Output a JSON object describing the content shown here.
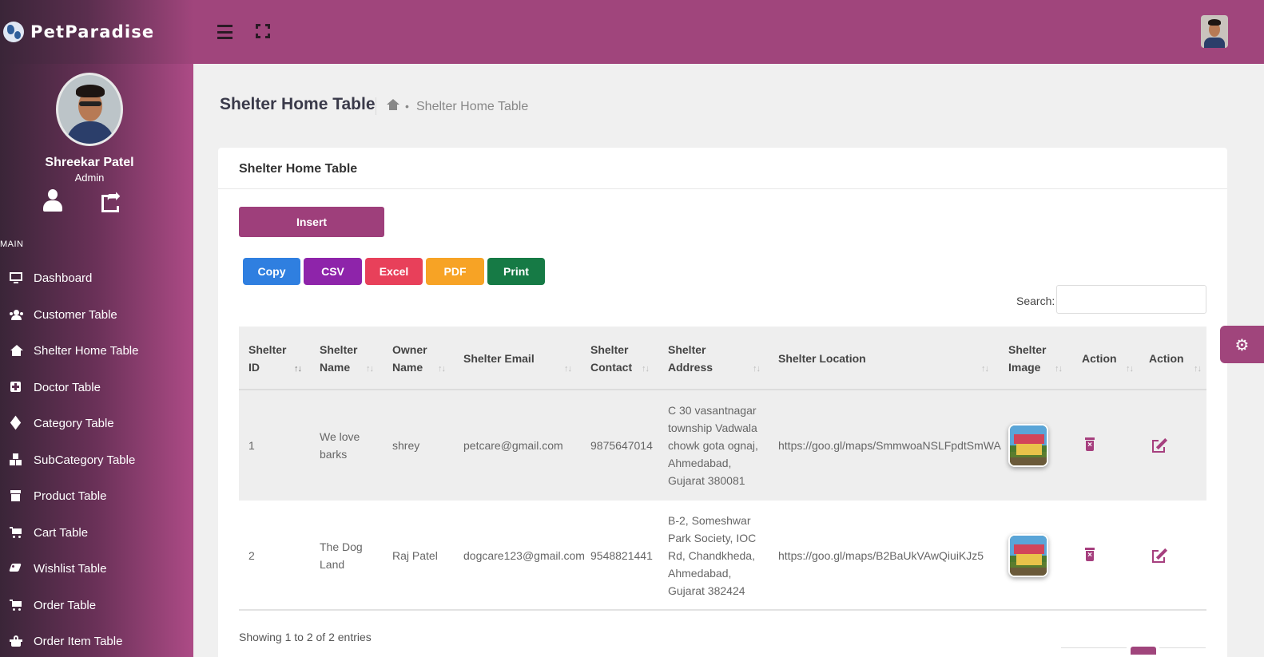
{
  "app": {
    "brand": "PetParadise"
  },
  "user": {
    "name": "Shreekar Patel",
    "role": "Admin"
  },
  "sidebar": {
    "section": "MAIN",
    "items": [
      {
        "label": "Dashboard",
        "icon": "monitor-icon"
      },
      {
        "label": "Customer Table",
        "icon": "users-icon"
      },
      {
        "label": "Shelter Home Table",
        "icon": "home-icon"
      },
      {
        "label": "Doctor Table",
        "icon": "medical-plus-icon"
      },
      {
        "label": "Category Table",
        "icon": "cube-icon"
      },
      {
        "label": "SubCategory Table",
        "icon": "cubes-icon"
      },
      {
        "label": "Product Table",
        "icon": "archive-icon"
      },
      {
        "label": "Cart Table",
        "icon": "cart-icon"
      },
      {
        "label": "Wishlist Table",
        "icon": "tags-icon"
      },
      {
        "label": "Order Table",
        "icon": "cart-icon"
      },
      {
        "label": "Order Item Table",
        "icon": "basket-icon"
      }
    ]
  },
  "page": {
    "title": "Shelter Home Table",
    "breadcrumb_current": "Shelter Home Table"
  },
  "card": {
    "title": "Shelter Home Table",
    "insert_label": "Insert",
    "export_buttons": [
      {
        "label": "Copy",
        "color": "#2f7fe0"
      },
      {
        "label": "CSV",
        "color": "#8e24aa"
      },
      {
        "label": "Excel",
        "color": "#e8405a"
      },
      {
        "label": "PDF",
        "color": "#f7a325"
      },
      {
        "label": "Print",
        "color": "#167a45"
      }
    ],
    "search_label": "Search:",
    "search_value": ""
  },
  "table": {
    "columns": [
      [
        "Shelter",
        "ID"
      ],
      [
        "Shelter",
        "Name"
      ],
      [
        "Owner",
        "Name"
      ],
      [
        "Shelter Email"
      ],
      [
        "Shelter",
        "Contact"
      ],
      [
        "Shelter",
        "Address"
      ],
      [
        "Shelter Location"
      ],
      [
        "Shelter",
        "Image"
      ],
      [
        "Action"
      ],
      [
        "Action"
      ]
    ],
    "rows": [
      {
        "id": "1",
        "name": [
          "We love",
          "barks"
        ],
        "owner": "shrey",
        "email": "petcare@gmail.com",
        "contact": "9875647014",
        "address": [
          "C 30 vasantnagar",
          "township Vadwala",
          "chowk gota ognaj,",
          "Ahmedabad,",
          "Gujarat 380081"
        ],
        "location": "https://goo.gl/maps/SmmwoaNSLFpdtSmWA"
      },
      {
        "id": "2",
        "name": [
          "The Dog",
          "Land"
        ],
        "owner": "Raj Patel",
        "email": "dogcare123@gmail.com",
        "contact": "9548821441",
        "address": [
          "B-2, Someshwar",
          "Park Society, IOC",
          "Rd, Chandkheda,",
          "Ahmedabad,",
          "Gujarat 382424"
        ],
        "location": "https://goo.gl/maps/B2BaUkVAwQiuiKJz5"
      }
    ],
    "info": "Showing 1 to 2 of 2 entries"
  },
  "colors": {
    "accent": "#a0457c",
    "action": "#a63f7e"
  }
}
